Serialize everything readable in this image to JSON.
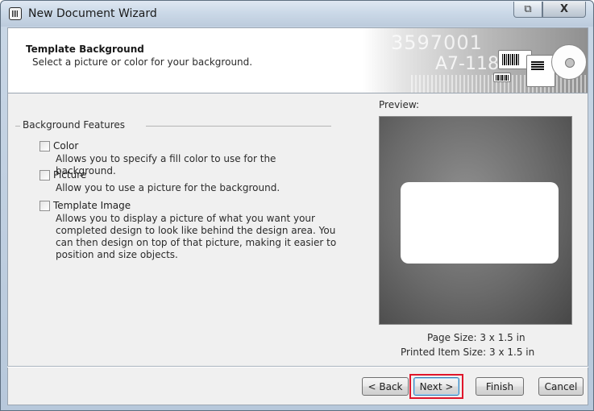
{
  "window": {
    "title": "New Document Wizard",
    "restore_glyph": "⧉",
    "close_glyph": "X"
  },
  "header": {
    "title": "Template Background",
    "subtitle": "Select a picture or color for your background.",
    "banner_text_1": "3597001",
    "banner_text_2": "A7-118"
  },
  "features": {
    "legend": "Background Features",
    "options": [
      {
        "label": "Color",
        "checked": false,
        "description": "Allows you to specify a fill color to use for the background."
      },
      {
        "label": "Picture",
        "checked": false,
        "description": "Allow you to use a picture for the background."
      },
      {
        "label": "Template Image",
        "checked": false,
        "description": "Allows you to display a picture of what you want your completed design to look like behind the design area. You can then design on top of that picture, making it easier to position and size objects."
      }
    ]
  },
  "preview": {
    "label": "Preview:",
    "page_size": "Page Size:  3 x 1.5 in",
    "printed_item_size": "Printed Item Size:  3 x 1.5 in"
  },
  "buttons": {
    "back": "< Back",
    "next": "Next >",
    "finish": "Finish",
    "cancel": "Cancel"
  },
  "colors": {
    "highlight": "#e0162b",
    "preview_bg": "#6a6a6a"
  }
}
